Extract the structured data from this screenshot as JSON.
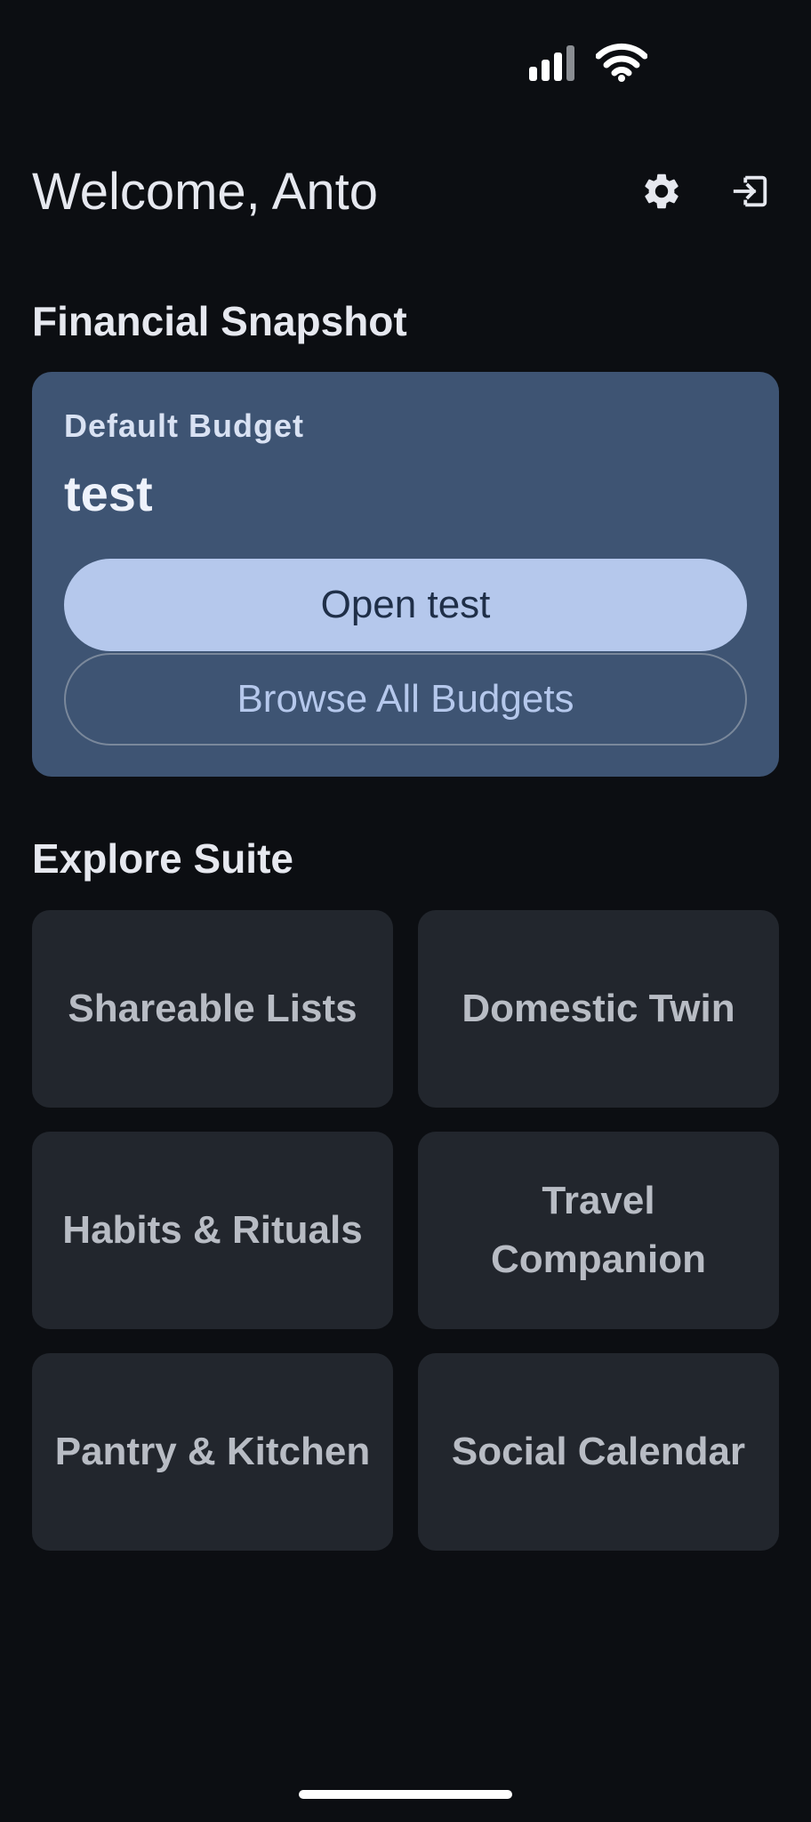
{
  "status_bar": {
    "signal_icon": "cellular-signal-icon",
    "wifi_icon": "wifi-icon"
  },
  "header": {
    "welcome": "Welcome, Anto",
    "settings_icon": "gear-icon",
    "logout_icon": "logout-icon"
  },
  "financial": {
    "section_title": "Financial Snapshot",
    "card_label": "Default Budget",
    "budget_name": "test",
    "open_button": "Open test",
    "browse_button": "Browse All Budgets"
  },
  "explore": {
    "section_title": "Explore Suite",
    "tiles": [
      "Shareable Lists",
      "Domestic Twin",
      "Habits & Rituals",
      "Travel Companion",
      "Pantry & Kitchen",
      "Social Calendar"
    ]
  },
  "colors": {
    "background": "#0c0e12",
    "card": "#3e5473",
    "primary_button": "#b5c8ec",
    "tile": "#22262d"
  }
}
